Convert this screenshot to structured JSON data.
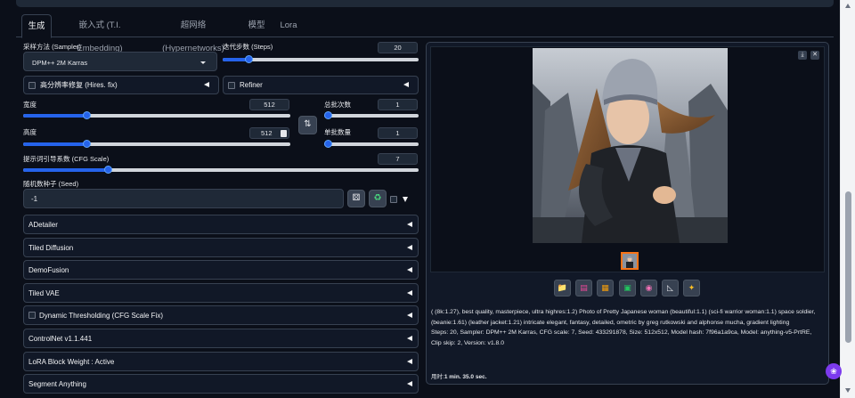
{
  "tabs": [
    "生成",
    "嵌入式 (T.I. Embedding)",
    "超网络 (Hypernetworks)",
    "模型",
    "Lora"
  ],
  "sampler": {
    "label": "采样方法 (Sampler)",
    "value": "DPM++ 2M Karras"
  },
  "steps": {
    "label": "迭代步数 (Steps)",
    "value": "20",
    "fraction": 0.12
  },
  "hires": {
    "label": "高分辨率修复 (Hires. fix)"
  },
  "refiner": {
    "label": "Refiner"
  },
  "width": {
    "label": "宽度",
    "value": "512",
    "fraction": 0.23
  },
  "height": {
    "label": "高度",
    "value": "512",
    "fraction": 0.23
  },
  "batch_count": {
    "label": "总批次数",
    "value": "1",
    "fraction": 0.0
  },
  "batch_size": {
    "label": "单批数量",
    "value": "1",
    "fraction": 0.0
  },
  "cfg": {
    "label": "提示词引导系数 (CFG Scale)",
    "value": "7",
    "fraction": 0.21
  },
  "seed": {
    "label": "随机数种子 (Seed)",
    "value": "-1"
  },
  "accordions": [
    {
      "label": "ADetailer",
      "checkbox": false
    },
    {
      "label": "Tiled Diffusion",
      "checkbox": false
    },
    {
      "label": "DemoFusion",
      "checkbox": false
    },
    {
      "label": "Tiled VAE",
      "checkbox": false
    },
    {
      "label": "Dynamic Thresholding (CFG Scale Fix)",
      "checkbox": true
    },
    {
      "label": "ControlNet v1.1.441",
      "checkbox": false
    },
    {
      "label": "LoRA Block Weight : Active",
      "checkbox": false
    },
    {
      "label": "Segment Anything",
      "checkbox": false
    }
  ],
  "info": {
    "prompt": "( (8k:1.27), best quality, masterpiece, ultra highres:1.2) Photo of Pretty Japanese woman (beautiful:1.1) (sci-fi warrior woman:1.1) space soldier, (beanie:1.61) (leather jacket:1.21) intricate elegant, fantasy, detailed, ometric by greg rutkowski and alphonse mucha, gradient lighting",
    "params": "Steps: 20, Sampler: DPM++ 2M Karras, CFG scale: 7, Seed: 433291878, Size: 512x512, Model hash: 7f96a1a9ca, Model: anything-v5-PrtRE, Clip skip: 2, Version: v1.8.0",
    "time_label": "用时:",
    "time_value": "1 min. 35.0 sec."
  },
  "colors": {
    "accent": "#2563eb",
    "background": "#0b0f19",
    "panel": "#111827"
  }
}
